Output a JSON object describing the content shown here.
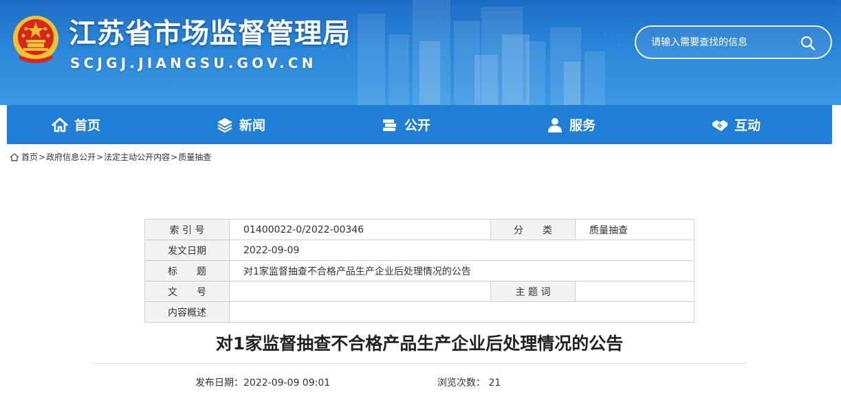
{
  "header": {
    "site_title": "江苏省市场监督管理局",
    "site_domain": "SCJGJ.JIANGSU.GOV.CN",
    "search_placeholder": "请输入需要查找的信息",
    "emblem_icon": "national-emblem-icon",
    "search_icon": "search-icon"
  },
  "nav": {
    "items": [
      {
        "label": "首页",
        "icon": "home-icon"
      },
      {
        "label": "新闻",
        "icon": "layers-icon"
      },
      {
        "label": "公开",
        "icon": "books-icon"
      },
      {
        "label": "服务",
        "icon": "people-icon"
      },
      {
        "label": "互动",
        "icon": "handshake-icon"
      }
    ]
  },
  "breadcrumb": {
    "items": [
      "首页",
      "政府信息公开",
      "法定主动公开内容",
      "质量抽查"
    ],
    "separator": ">"
  },
  "info_table": {
    "index_label": "索 引 号",
    "index_value": "01400022-0/2022-00346",
    "category_label": "分　　类",
    "category_value": "质量抽查",
    "date_label": "发文日期",
    "date_value": "2022-09-09",
    "title_label": "标　　题",
    "title_value": "对1家监督抽查不合格产品生产企业后处理情况的公告",
    "docno_label": "文　　号",
    "docno_value": "",
    "keywords_label": "主 题 词",
    "keywords_value": "",
    "summary_label": "内容概述",
    "summary_value": ""
  },
  "article": {
    "title": "对1家监督抽查不合格产品生产企业后处理情况的公告",
    "publish_label": "发布日期：",
    "publish_value": "2022-09-09 09:01",
    "views_label": "浏览次数：",
    "views_value": "21"
  },
  "colors": {
    "banner": "#2a86d8",
    "nav": "#1f7fd7",
    "emblem_red": "#d7261e",
    "emblem_gold": "#f2c230"
  }
}
